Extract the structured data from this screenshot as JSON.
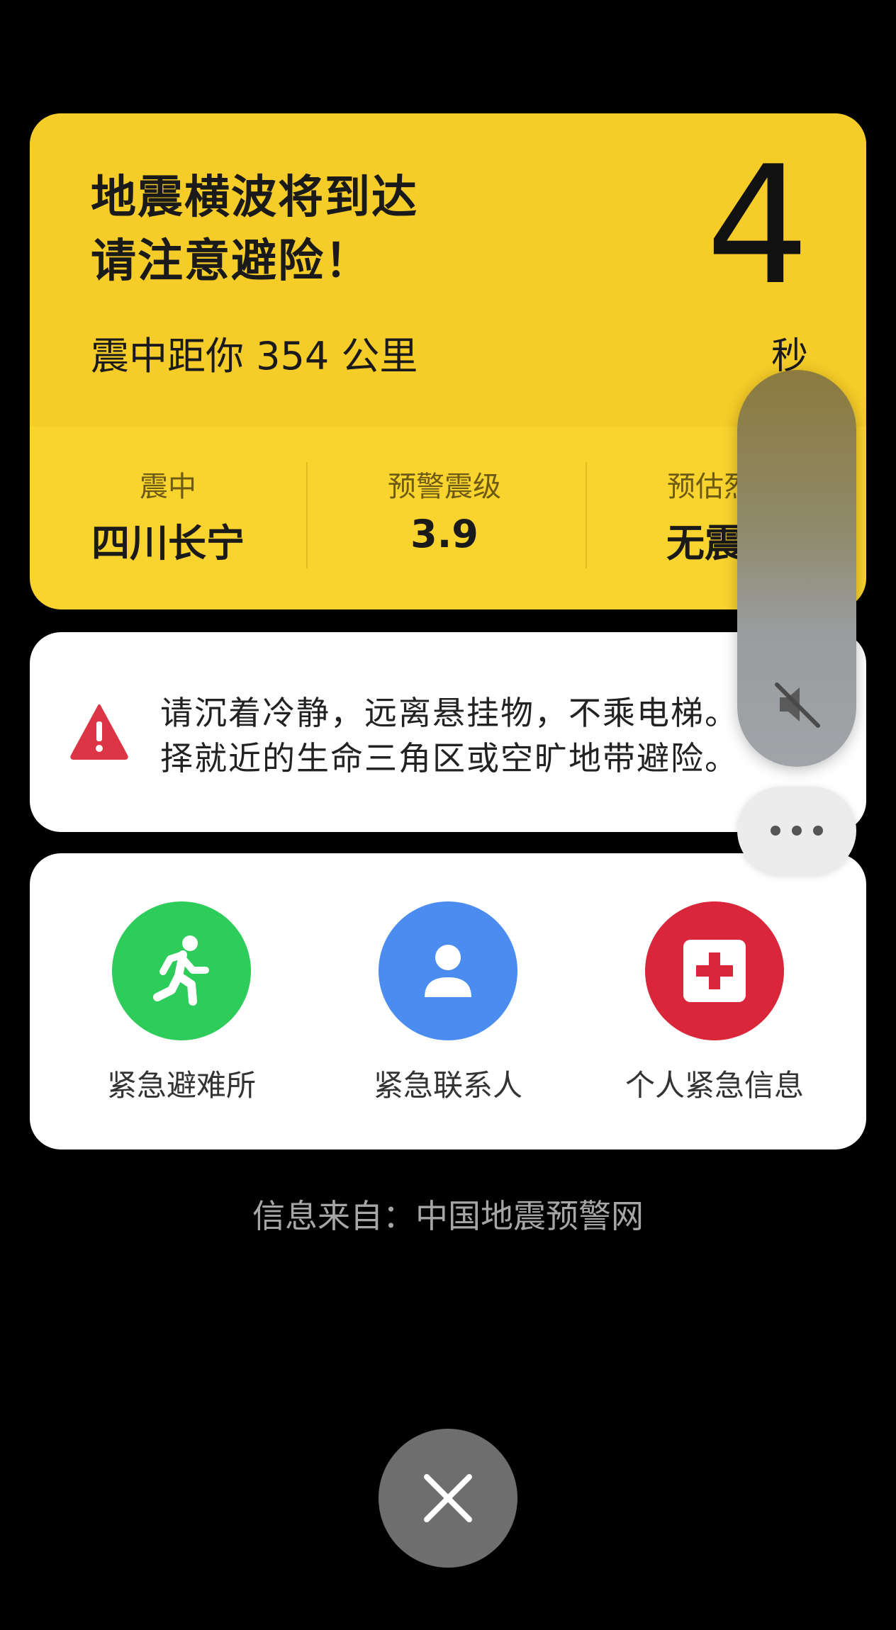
{
  "alert": {
    "title_line1": "地震横波将到达",
    "title_line2": "请注意避险！",
    "distance": "震中距你 354 公里",
    "countdown": "4",
    "countdown_unit": "秒",
    "stats": [
      {
        "label": "震中",
        "value": "四川长宁"
      },
      {
        "label": "预警震级",
        "value": "3.9"
      },
      {
        "label": "预估烈度",
        "value": "无震感"
      }
    ],
    "color": "#f9d32e"
  },
  "advice": {
    "line1": "请沉着冷静，远离悬挂物，不乘电梯。",
    "line2": "择就近的生命三角区或空旷地带避险。",
    "icon": "warning-triangle-icon",
    "icon_color": "#dc3545"
  },
  "actions": [
    {
      "label": "紧急避难所",
      "icon": "running-person-icon",
      "color": "#2ecc5a"
    },
    {
      "label": "紧急联系人",
      "icon": "person-icon",
      "color": "#4a8cf0"
    },
    {
      "label": "个人紧急信息",
      "icon": "medical-cross-icon",
      "color": "#d9263a"
    }
  ],
  "source": "信息来自：中国地震预警网",
  "volume": {
    "icon": "mute-icon"
  },
  "controls": {
    "more_icon": "more-dots-icon",
    "close_icon": "close-icon"
  }
}
